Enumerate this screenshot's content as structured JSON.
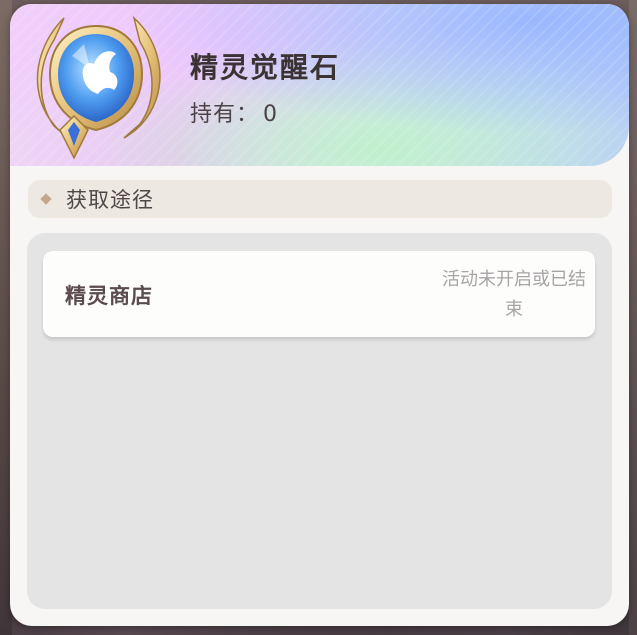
{
  "item": {
    "name": "精灵觉醒石",
    "owned_label": "持有：",
    "owned_count": "0",
    "icon": "spirit-awakening-stone-icon"
  },
  "acquire": {
    "section_title": "获取途径",
    "sources": [
      {
        "name": "精灵商店",
        "status": "活动未开启或已结束"
      }
    ]
  },
  "colors": {
    "title_text": "#3b3234",
    "section_bg": "#ede8e2",
    "panel_bg": "#e4e4e4",
    "accent_diamond": "#c6a58d",
    "status_text": "#a8a4a5"
  }
}
